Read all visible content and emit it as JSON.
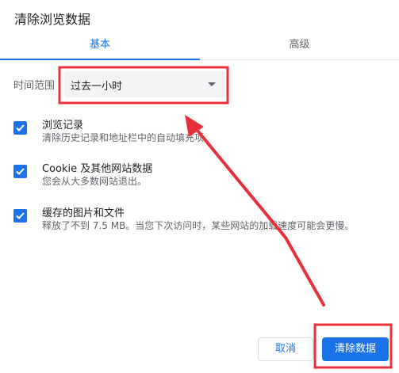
{
  "dialog": {
    "title": "清除浏览数据"
  },
  "tabs": [
    {
      "label": "基本",
      "active": true
    },
    {
      "label": "高级",
      "active": false
    }
  ],
  "time_range": {
    "label": "时间范围",
    "selected": "过去一小时"
  },
  "options": [
    {
      "title": "浏览记录",
      "description": "清除历史记录和地址栏中的自动填充项。",
      "checked": true
    },
    {
      "title": "Cookie 及其他网站数据",
      "description": "您会从大多数网站退出。",
      "checked": true
    },
    {
      "title": "缓存的图片和文件",
      "description": "释放了不到 7.5 MB。当您下次访问时，某些网站的加载速度可能会更慢。",
      "checked": true
    }
  ],
  "buttons": {
    "cancel": "取消",
    "clear": "清除数据"
  },
  "colors": {
    "accent": "#1a73e8",
    "annotation": "#e8303a"
  }
}
